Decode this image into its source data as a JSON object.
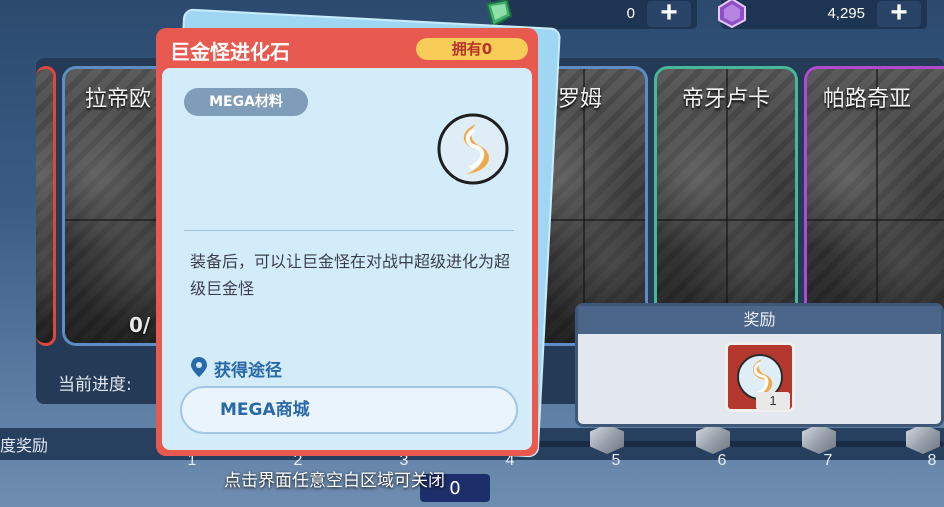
{
  "currency": {
    "gems": {
      "icon": "green-gem-icon",
      "value": "0"
    },
    "crystals": {
      "icon": "purple-crystal-icon",
      "value": "4,295"
    }
  },
  "cards": [
    {
      "name": "",
      "count": ""
    },
    {
      "name": "拉帝欧",
      "count": "0/"
    },
    {
      "name": "克罗姆",
      "count": ""
    },
    {
      "name": "帝牙卢卡",
      "count": ""
    },
    {
      "name": "帕路奇亚",
      "count": ""
    }
  ],
  "progress": {
    "label": "当前进度:"
  },
  "track": {
    "label": "度奖励",
    "milestones": [
      "1",
      "2",
      "3",
      "4",
      "5",
      "6",
      "7",
      "8"
    ]
  },
  "counter_chip": "0",
  "reward": {
    "title": "奖励",
    "qty": "1"
  },
  "popup": {
    "title": "巨金怪进化石",
    "owned": "拥有0",
    "tag": "MEGA材料",
    "description": "装备后，可以让巨金怪在对战中超级进化为超级巨金怪",
    "source_label": "获得途径",
    "source_button": "MEGA商城"
  },
  "close_hint": "点击界面任意空白区域可关闭",
  "colors": {
    "popup_header": "#e85a50",
    "popup_body": "#d3ecfa",
    "badge": "#f7cd57",
    "accent_blue": "#2a69a8"
  }
}
